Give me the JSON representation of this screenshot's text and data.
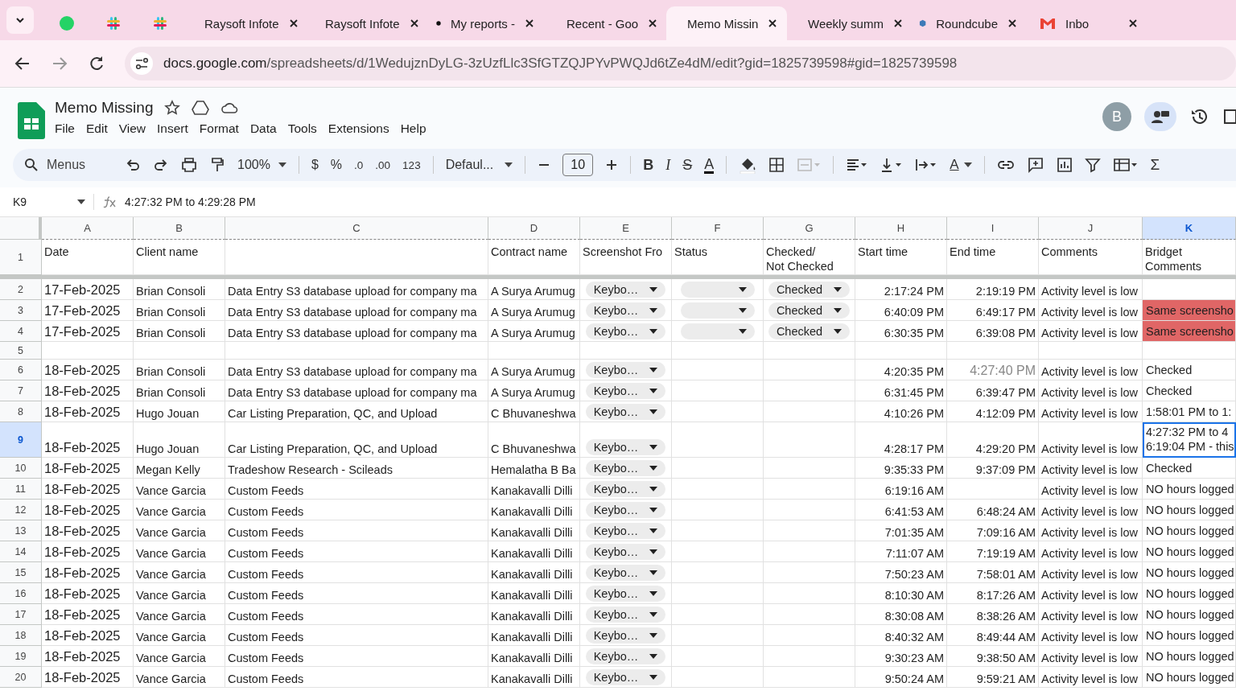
{
  "browser": {
    "tabs": [
      {
        "selected": false
      },
      {
        "selected": false
      },
      {
        "selected": false
      },
      {
        "title": "Raysoft Infote",
        "selected": false
      },
      {
        "title": "Raysoft Infote",
        "selected": false
      },
      {
        "title": "My reports -",
        "selected": false
      },
      {
        "title": "Recent - Goo",
        "selected": false
      },
      {
        "title": "Memo Missin",
        "selected": true
      },
      {
        "title": "Weekly summ",
        "selected": false
      },
      {
        "title": "Roundcube",
        "selected": false
      },
      {
        "title": "Inbo",
        "selected": false
      }
    ],
    "url_domain": "docs.google.com",
    "url_path": "/spreadsheets/d/1WedujznDyLG-3zUzfLlc3SfGTZQJPYvPWQJd6tZe4dM/edit?gid=1825739598#gid=1825739598"
  },
  "doc": {
    "title": "Memo Missing",
    "menus": [
      "File",
      "Edit",
      "View",
      "Insert",
      "Format",
      "Data",
      "Tools",
      "Extensions",
      "Help"
    ],
    "avatar": "B"
  },
  "toolbar": {
    "search": "Menus",
    "zoom": "100%",
    "currency": "$",
    "percent": "%",
    "dec_less": ".0",
    "dec_more": ".00",
    "number_format": "123",
    "font": "Defaul...",
    "font_size": "10",
    "bold": "B",
    "italic": "I",
    "strike": "S",
    "text_color": "A",
    "rotate": "A",
    "functions": "Σ"
  },
  "formula_bar": {
    "cell": "K9",
    "formula": "4:27:32 PM to 4:29:28 PM"
  },
  "header_row_num": "1",
  "columns": [
    {
      "letter": "A",
      "header": [
        "Date"
      ],
      "selected": false
    },
    {
      "letter": "B",
      "header": [
        "Client name"
      ],
      "selected": false
    },
    {
      "letter": "C",
      "selected": false
    },
    {
      "letter": "D",
      "header": [
        "Contract name"
      ],
      "selected": false
    },
    {
      "letter": "E",
      "header": [
        "Screenshot Fro"
      ],
      "selected": false
    },
    {
      "letter": "F",
      "header": [
        "Status"
      ],
      "selected": false
    },
    {
      "letter": "G",
      "header": [
        "Checked/",
        "Not Checked"
      ],
      "selected": false
    },
    {
      "letter": "H",
      "header": [
        "Start time"
      ],
      "selected": false
    },
    {
      "letter": "I",
      "header": [
        "End time"
      ],
      "selected": false
    },
    {
      "letter": "J",
      "header": [
        "Comments"
      ],
      "selected": false
    },
    {
      "letter": "K",
      "header": [
        "Bridget",
        "Comments"
      ],
      "selected": true
    }
  ],
  "rows": [
    {
      "num": "2",
      "selected": false,
      "date": "17-Feb-2025",
      "client": "Brian Consoli",
      "task": "Data Entry S3 database upload for company ma",
      "contract": "A Surya Arumug",
      "screenshot": "Keybo…",
      "status_chip": true,
      "checked": "Checked",
      "start": "2:17:24 PM",
      "end": "2:19:19 PM",
      "comments": "Activity level is low"
    },
    {
      "num": "3",
      "selected": false,
      "date": "17-Feb-2025",
      "client": "Brian Consoli",
      "task": "Data Entry S3 database upload for company ma",
      "contract": "A Surya Arumug",
      "screenshot": "Keybo…",
      "status_chip": true,
      "checked": "Checked",
      "start": "6:40:09 PM",
      "end": "6:49:17 PM",
      "comments": "Activity level is low",
      "bridget": [
        "Same screensho"
      ],
      "color": "#e06666"
    },
    {
      "num": "4",
      "selected": false,
      "date": "17-Feb-2025",
      "client": "Brian Consoli",
      "task": "Data Entry S3 database upload for company ma",
      "contract": "A Surya Arumug",
      "screenshot": "Keybo…",
      "status_chip": true,
      "checked": "Checked",
      "start": "6:30:35 PM",
      "end": "6:39:08 PM",
      "comments": "Activity level is low",
      "bridget": [
        "Same screensho"
      ],
      "color": "#e06666"
    },
    {
      "num": "5",
      "selected": false
    },
    {
      "num": "6",
      "selected": false,
      "date": "18-Feb-2025",
      "client": "Brian Consoli",
      "task": "Data Entry S3 database upload for company ma",
      "contract": "A Surya Arumug",
      "screenshot": "Keybo…",
      "start": "4:20:35 PM",
      "end": "4:27:40 PM",
      "end_faded": true,
      "comments": "Activity level is low",
      "bridget": [
        "Checked"
      ]
    },
    {
      "num": "7",
      "selected": false,
      "date": "18-Feb-2025",
      "client": "Brian Consoli",
      "task": "Data Entry S3 database upload for company ma",
      "contract": "A Surya Arumug",
      "screenshot": "Keybo…",
      "start": "6:31:45 PM",
      "end": "6:39:47 PM",
      "comments": "Activity level is low",
      "bridget": [
        "Checked"
      ]
    },
    {
      "num": "8",
      "selected": false,
      "date": "18-Feb-2025",
      "client": "Hugo Jouan",
      "task": "Car Listing Preparation, QC, and Upload",
      "contract": "C Bhuvaneshwa",
      "screenshot": "Keybo…",
      "start": "4:10:26 PM",
      "end": "4:12:09 PM",
      "comments": "Activity level is low",
      "bridget": [
        "1:58:01 PM to 1:"
      ]
    },
    {
      "num": "9",
      "selected": true,
      "date": "18-Feb-2025",
      "client": "Hugo Jouan",
      "task": "Car Listing Preparation, QC, and Upload",
      "contract": "C Bhuvaneshwa",
      "screenshot": "Keybo…",
      "start": "4:28:17 PM",
      "end": "4:29:20 PM",
      "comments": "Activity level is low",
      "bridget": [
        "4:27:32 PM to 4",
        "6:19:04 PM - this"
      ]
    },
    {
      "num": "10",
      "selected": false,
      "date": "18-Feb-2025",
      "client": "Megan Kelly",
      "task": "Tradeshow Research - Scileads",
      "contract": "Hemalatha B Ba",
      "screenshot": "Keybo…",
      "start": "9:35:33 PM",
      "end": "9:37:09 PM",
      "comments": "Activity level is low",
      "bridget": [
        "Checked"
      ]
    },
    {
      "num": "11",
      "selected": false,
      "date": "18-Feb-2025",
      "client": "Vance Garcia",
      "task": "Custom Feeds",
      "contract": "Kanakavalli Dilli",
      "screenshot": "Keybo…",
      "start": "6:19:16 AM",
      "comments": "Activity level is low",
      "bridget": [
        "NO hours logged"
      ]
    },
    {
      "num": "12",
      "selected": false,
      "date": "18-Feb-2025",
      "client": "Vance Garcia",
      "task": "Custom Feeds",
      "contract": "Kanakavalli Dilli",
      "screenshot": "Keybo…",
      "start": "6:41:53 AM",
      "end": "6:48:24 AM",
      "comments": "Activity level is low",
      "bridget": [
        "NO hours logged"
      ]
    },
    {
      "num": "13",
      "selected": false,
      "date": "18-Feb-2025",
      "client": "Vance Garcia",
      "task": "Custom Feeds",
      "contract": "Kanakavalli Dilli",
      "screenshot": "Keybo…",
      "start": "7:01:35 AM",
      "end": "7:09:16 AM",
      "comments": "Activity level is low",
      "bridget": [
        "NO hours logged"
      ]
    },
    {
      "num": "14",
      "selected": false,
      "date": "18-Feb-2025",
      "client": "Vance Garcia",
      "task": "Custom Feeds",
      "contract": "Kanakavalli Dilli",
      "screenshot": "Keybo…",
      "start": "7:11:07 AM",
      "end": "7:19:19 AM",
      "comments": "Activity level is low",
      "bridget": [
        "NO hours logged"
      ]
    },
    {
      "num": "15",
      "selected": false,
      "date": "18-Feb-2025",
      "client": "Vance Garcia",
      "task": "Custom Feeds",
      "contract": "Kanakavalli Dilli",
      "screenshot": "Keybo…",
      "start": "7:50:23 AM",
      "end": "7:58:01 AM",
      "comments": "Activity level is low",
      "bridget": [
        "NO hours logged"
      ]
    },
    {
      "num": "16",
      "selected": false,
      "date": "18-Feb-2025",
      "client": "Vance Garcia",
      "task": "Custom Feeds",
      "contract": "Kanakavalli Dilli",
      "screenshot": "Keybo…",
      "start": "8:10:30 AM",
      "end": "8:17:26 AM",
      "comments": "Activity level is low",
      "bridget": [
        "NO hours logged"
      ]
    },
    {
      "num": "17",
      "selected": false,
      "date": "18-Feb-2025",
      "client": "Vance Garcia",
      "task": "Custom Feeds",
      "contract": "Kanakavalli Dilli",
      "screenshot": "Keybo…",
      "start": "8:30:08 AM",
      "end": "8:38:26 AM",
      "comments": "Activity level is low",
      "bridget": [
        "NO hours logged"
      ]
    },
    {
      "num": "18",
      "selected": false,
      "date": "18-Feb-2025",
      "client": "Vance Garcia",
      "task": "Custom Feeds",
      "contract": "Kanakavalli Dilli",
      "screenshot": "Keybo…",
      "start": "8:40:32 AM",
      "end": "8:49:44 AM",
      "comments": "Activity level is low",
      "bridget": [
        "NO hours logged"
      ]
    },
    {
      "num": "19",
      "selected": false,
      "date": "18-Feb-2025",
      "client": "Vance Garcia",
      "task": "Custom Feeds",
      "contract": "Kanakavalli Dilli",
      "screenshot": "Keybo…",
      "start": "9:30:23 AM",
      "end": "9:38:50 AM",
      "comments": "Activity level is low",
      "bridget": [
        "NO hours logged"
      ]
    },
    {
      "num": "20",
      "selected": false,
      "date": "18-Feb-2025",
      "client": "Vance Garcia",
      "task": "Custom Feeds",
      "contract": "Kanakavalli Dilli",
      "screenshot": "Keybo…",
      "start": "9:50:24 AM",
      "end": "9:59:21 AM",
      "comments": "Activity level is low",
      "bridget": [
        "NO hours logged"
      ]
    }
  ]
}
